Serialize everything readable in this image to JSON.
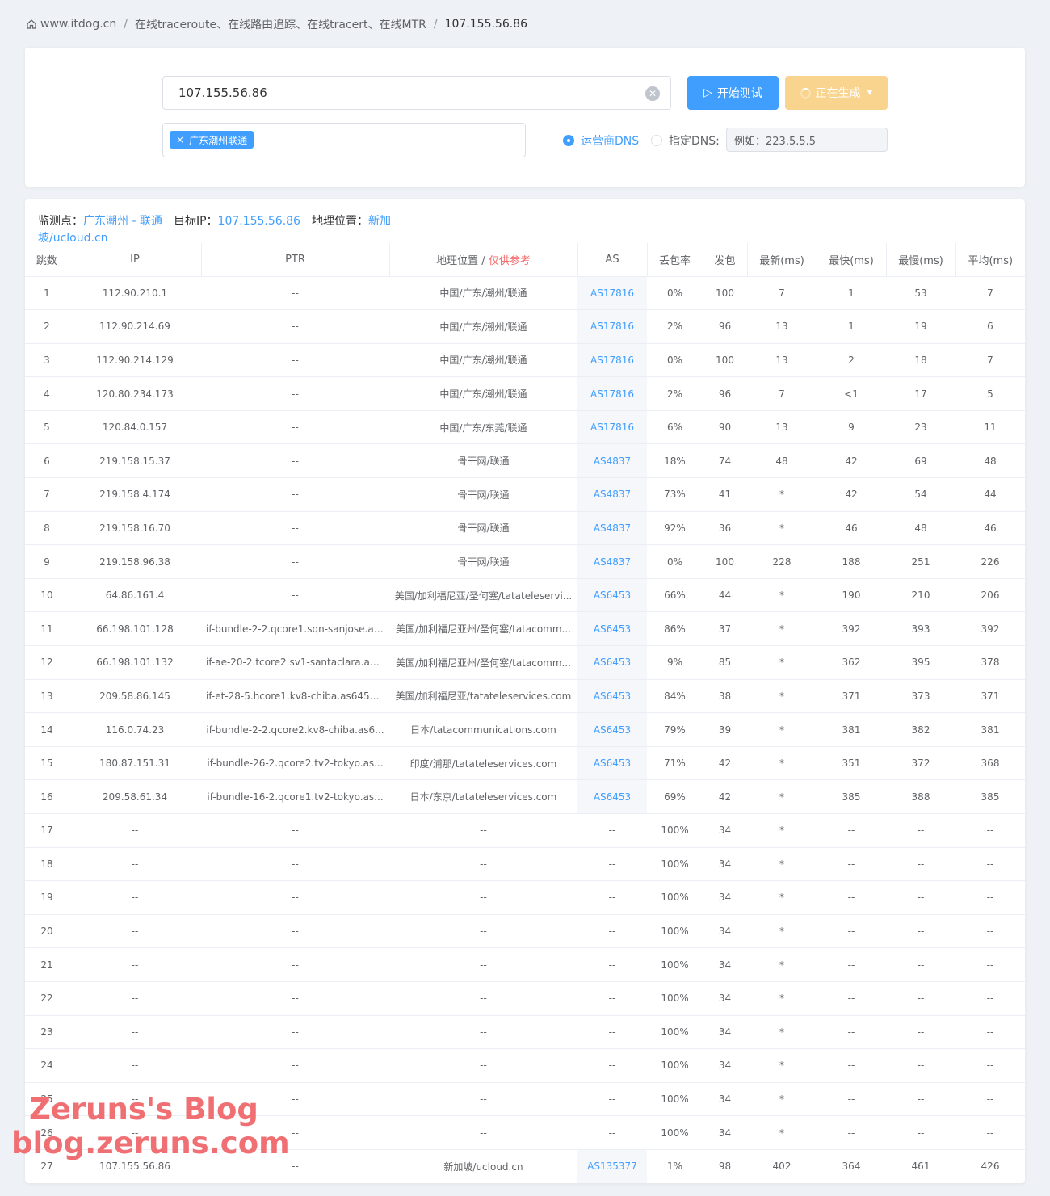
{
  "breadcrumb": {
    "home": "www.itdog.cn",
    "section": "在线traceroute、在线路由追踪、在线tracert、在线MTR",
    "current": "107.155.56.86"
  },
  "form": {
    "target_value": "107.155.56.86",
    "start_label": "开始测试",
    "generating_label": "正在生成",
    "node_tag": "广东潮州联通",
    "dns_isp_label": "运营商DNS",
    "dns_custom_label": "指定DNS:",
    "dns_placeholder": "例如：223.5.5.5"
  },
  "summary": {
    "monitor_label": "监测点：",
    "monitor_value": "广东潮州 - 联通",
    "target_label": "目标IP：",
    "target_value": "107.155.56.86",
    "geo_label": "地理位置：",
    "geo_value": "新加坡/ucloud.cn"
  },
  "table": {
    "headers": {
      "hop": "跳数",
      "ip": "IP",
      "ptr": "PTR",
      "geo": "地理位置 / ",
      "geo_note": "仅供参考",
      "as": "AS",
      "loss": "丢包率",
      "sent": "发包",
      "last": "最新(ms)",
      "best": "最快(ms)",
      "worst": "最慢(ms)",
      "avg": "平均(ms)"
    },
    "rows": [
      [
        "1",
        "112.90.210.1",
        "--",
        "中国/广东/潮州/联通",
        "AS17816",
        "0%",
        "100",
        "7",
        "1",
        "53",
        "7"
      ],
      [
        "2",
        "112.90.214.69",
        "--",
        "中国/广东/潮州/联通",
        "AS17816",
        "2%",
        "96",
        "13",
        "1",
        "19",
        "6"
      ],
      [
        "3",
        "112.90.214.129",
        "--",
        "中国/广东/潮州/联通",
        "AS17816",
        "0%",
        "100",
        "13",
        "2",
        "18",
        "7"
      ],
      [
        "4",
        "120.80.234.173",
        "--",
        "中国/广东/潮州/联通",
        "AS17816",
        "2%",
        "96",
        "7",
        "<1",
        "17",
        "5"
      ],
      [
        "5",
        "120.84.0.157",
        "--",
        "中国/广东/东莞/联通",
        "AS17816",
        "6%",
        "90",
        "13",
        "9",
        "23",
        "11"
      ],
      [
        "6",
        "219.158.15.37",
        "--",
        "骨干网/联通",
        "AS4837",
        "18%",
        "74",
        "48",
        "42",
        "69",
        "48"
      ],
      [
        "7",
        "219.158.4.174",
        "--",
        "骨干网/联通",
        "AS4837",
        "73%",
        "41",
        "*",
        "42",
        "54",
        "44"
      ],
      [
        "8",
        "219.158.16.70",
        "--",
        "骨干网/联通",
        "AS4837",
        "92%",
        "36",
        "*",
        "46",
        "48",
        "46"
      ],
      [
        "9",
        "219.158.96.38",
        "--",
        "骨干网/联通",
        "AS4837",
        "0%",
        "100",
        "228",
        "188",
        "251",
        "226"
      ],
      [
        "10",
        "64.86.161.4",
        "--",
        "美国/加利福尼亚/圣何塞/tatateleservi...",
        "AS6453",
        "66%",
        "44",
        "*",
        "190",
        "210",
        "206"
      ],
      [
        "11",
        "66.198.101.128",
        "if-bundle-2-2.qcore1.sqn-sanjose.as...",
        "美国/加利福尼亚州/圣何塞/tatacomm...",
        "AS6453",
        "86%",
        "37",
        "*",
        "392",
        "393",
        "392"
      ],
      [
        "12",
        "66.198.101.132",
        "if-ae-20-2.tcore2.sv1-santaclara.as6...",
        "美国/加利福尼亚州/圣何塞/tatacomm...",
        "AS6453",
        "9%",
        "85",
        "*",
        "362",
        "395",
        "378"
      ],
      [
        "13",
        "209.58.86.145",
        "if-et-28-5.hcore1.kv8-chiba.as6453....",
        "美国/加利福尼亚/tatateleservices.com",
        "AS6453",
        "84%",
        "38",
        "*",
        "371",
        "373",
        "371"
      ],
      [
        "14",
        "116.0.74.23",
        "if-bundle-2-2.qcore2.kv8-chiba.as6...",
        "日本/tatacommunications.com",
        "AS6453",
        "79%",
        "39",
        "*",
        "381",
        "382",
        "381"
      ],
      [
        "15",
        "180.87.151.31",
        "if-bundle-26-2.qcore2.tv2-tokyo.as...",
        "印度/浦那/tatateleservices.com",
        "AS6453",
        "71%",
        "42",
        "*",
        "351",
        "372",
        "368"
      ],
      [
        "16",
        "209.58.61.34",
        "if-bundle-16-2.qcore1.tv2-tokyo.as...",
        "日本/东京/tatateleservices.com",
        "AS6453",
        "69%",
        "42",
        "*",
        "385",
        "388",
        "385"
      ],
      [
        "17",
        "--",
        "--",
        "--",
        "--",
        "100%",
        "34",
        "*",
        "--",
        "--",
        "--"
      ],
      [
        "18",
        "--",
        "--",
        "--",
        "--",
        "100%",
        "34",
        "*",
        "--",
        "--",
        "--"
      ],
      [
        "19",
        "--",
        "--",
        "--",
        "--",
        "100%",
        "34",
        "*",
        "--",
        "--",
        "--"
      ],
      [
        "20",
        "--",
        "--",
        "--",
        "--",
        "100%",
        "34",
        "*",
        "--",
        "--",
        "--"
      ],
      [
        "21",
        "--",
        "--",
        "--",
        "--",
        "100%",
        "34",
        "*",
        "--",
        "--",
        "--"
      ],
      [
        "22",
        "--",
        "--",
        "--",
        "--",
        "100%",
        "34",
        "*",
        "--",
        "--",
        "--"
      ],
      [
        "23",
        "--",
        "--",
        "--",
        "--",
        "100%",
        "34",
        "*",
        "--",
        "--",
        "--"
      ],
      [
        "24",
        "--",
        "--",
        "--",
        "--",
        "100%",
        "34",
        "*",
        "--",
        "--",
        "--"
      ],
      [
        "25",
        "--",
        "--",
        "--",
        "--",
        "100%",
        "34",
        "*",
        "--",
        "--",
        "--"
      ],
      [
        "26",
        "--",
        "--",
        "--",
        "--",
        "100%",
        "34",
        "*",
        "--",
        "--",
        "--"
      ],
      [
        "27",
        "107.155.56.86",
        "--",
        "新加坡/ucloud.cn",
        "AS135377",
        "1%",
        "98",
        "402",
        "364",
        "461",
        "426"
      ]
    ]
  },
  "watermark": {
    "line1": "Zeruns's Blog",
    "line2": "blog.zeruns.com"
  },
  "colors": {
    "primary": "#409eff",
    "warning_light": "#f9d48f",
    "danger": "#f56c6c"
  }
}
